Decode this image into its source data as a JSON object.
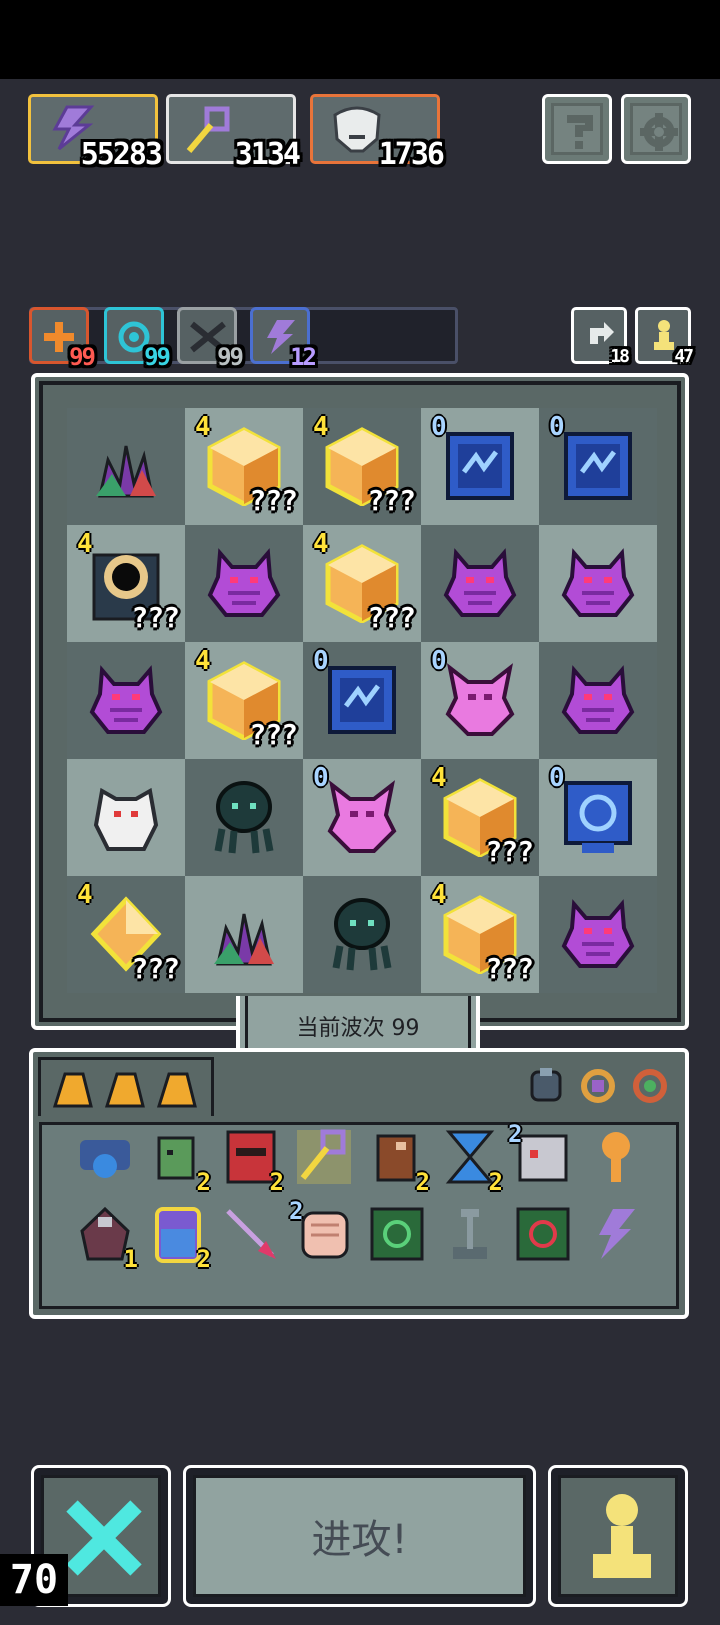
{
  "resources": [
    {
      "name": "energy-icon",
      "value": "55283",
      "border": "#f2c23e"
    },
    {
      "name": "magic-wand-icon",
      "value": "3134",
      "border": "#e6e6e6"
    },
    {
      "name": "helmet-icon",
      "value": "1736",
      "border": "#e8743a"
    }
  ],
  "top_buttons": [
    {
      "name": "help-icon"
    },
    {
      "name": "settings-icon"
    }
  ],
  "buffs": [
    {
      "name": "attack-buff-icon",
      "value": "99",
      "border": "#d8562e",
      "numcolor": "#ff5a52"
    },
    {
      "name": "spiral-buff-icon",
      "value": "99",
      "border": "#2ec4d6",
      "numcolor": "#38d4e4"
    },
    {
      "name": "sword-buff-icon",
      "value": "99",
      "border": "#9aa0a3",
      "numcolor": "#b9c0c2"
    },
    {
      "name": "lightning-buff-icon",
      "value": "12",
      "border": "#4b6fd0",
      "numcolor": "#b89cff"
    }
  ],
  "side_counters": [
    {
      "name": "reroll-icon",
      "value": "18"
    },
    {
      "name": "pawn-count-icon",
      "value": "47"
    }
  ],
  "board": {
    "rows": [
      [
        {
          "sprite": "crystal-plant",
          "lvl": "",
          "q": ""
        },
        {
          "sprite": "amber-gem",
          "lvl": "4",
          "q": "???"
        },
        {
          "sprite": "amber-gem",
          "lvl": "4",
          "q": "???"
        },
        {
          "sprite": "blue-tablet",
          "lvl": "0",
          "q": ""
        },
        {
          "sprite": "blue-tablet",
          "lvl": "0",
          "q": ""
        }
      ],
      [
        {
          "sprite": "dark-portal",
          "lvl": "4",
          "q": "???"
        },
        {
          "sprite": "purple-demon",
          "lvl": "",
          "q": ""
        },
        {
          "sprite": "amber-gem",
          "lvl": "4",
          "q": "???"
        },
        {
          "sprite": "purple-demon",
          "lvl": "",
          "q": ""
        },
        {
          "sprite": "purple-demon",
          "lvl": "",
          "q": ""
        }
      ],
      [
        {
          "sprite": "purple-demon",
          "lvl": "",
          "q": ""
        },
        {
          "sprite": "amber-gem",
          "lvl": "4",
          "q": "???"
        },
        {
          "sprite": "blue-tablet",
          "lvl": "0",
          "q": ""
        },
        {
          "sprite": "pink-demon",
          "lvl": "0",
          "q": ""
        },
        {
          "sprite": "purple-demon",
          "lvl": "",
          "q": ""
        }
      ],
      [
        {
          "sprite": "white-golem",
          "lvl": "",
          "q": ""
        },
        {
          "sprite": "dark-squid",
          "lvl": "",
          "q": ""
        },
        {
          "sprite": "pink-demon",
          "lvl": "0",
          "q": ""
        },
        {
          "sprite": "amber-gem",
          "lvl": "4",
          "q": "???"
        },
        {
          "sprite": "blue-clock-tablet",
          "lvl": "0",
          "q": ""
        }
      ],
      [
        {
          "sprite": "amber-crystal",
          "lvl": "4",
          "q": "???"
        },
        {
          "sprite": "crystal-plant",
          "lvl": "",
          "q": ""
        },
        {
          "sprite": "dark-squid",
          "lvl": "",
          "q": ""
        },
        {
          "sprite": "amber-gem",
          "lvl": "4",
          "q": "???"
        },
        {
          "sprite": "purple-demon",
          "lvl": "",
          "q": ""
        }
      ]
    ]
  },
  "wave_label": "当前波次 99",
  "inventory": {
    "tabs": [
      "shard-icon",
      "shard-icon",
      "shard-icon"
    ],
    "filters": [
      "armor-filter-icon",
      "ring-filter-icon",
      "amulet-filter-icon"
    ],
    "row1": [
      {
        "name": "blue-orb-item",
        "n": ""
      },
      {
        "name": "green-goblin-item",
        "n": "2"
      },
      {
        "name": "red-tome-item",
        "n": "2"
      },
      {
        "name": "magic-wand-item",
        "n": ""
      },
      {
        "name": "brown-beast-item",
        "n": "2"
      },
      {
        "name": "hourglass-item",
        "n": "2"
      },
      {
        "name": "robot-item",
        "n": "",
        "n2": "2"
      },
      {
        "name": "orange-key-item",
        "n": ""
      }
    ],
    "row2": [
      {
        "name": "anchor-item",
        "n": "1"
      },
      {
        "name": "potion-jar-item",
        "n": "2"
      },
      {
        "name": "arrow-item",
        "n": ""
      },
      {
        "name": "fist-item",
        "n": "",
        "n2": "2"
      },
      {
        "name": "green-rune-item",
        "n": ""
      },
      {
        "name": "lever-item",
        "n": ""
      },
      {
        "name": "red-rune-item",
        "n": ""
      },
      {
        "name": "purple-lightning-item",
        "n": ""
      }
    ]
  },
  "actions": {
    "cancel": "cancel-x-icon",
    "attack_label": "进攻!",
    "pawn": "pawn-icon"
  },
  "fps": "70"
}
